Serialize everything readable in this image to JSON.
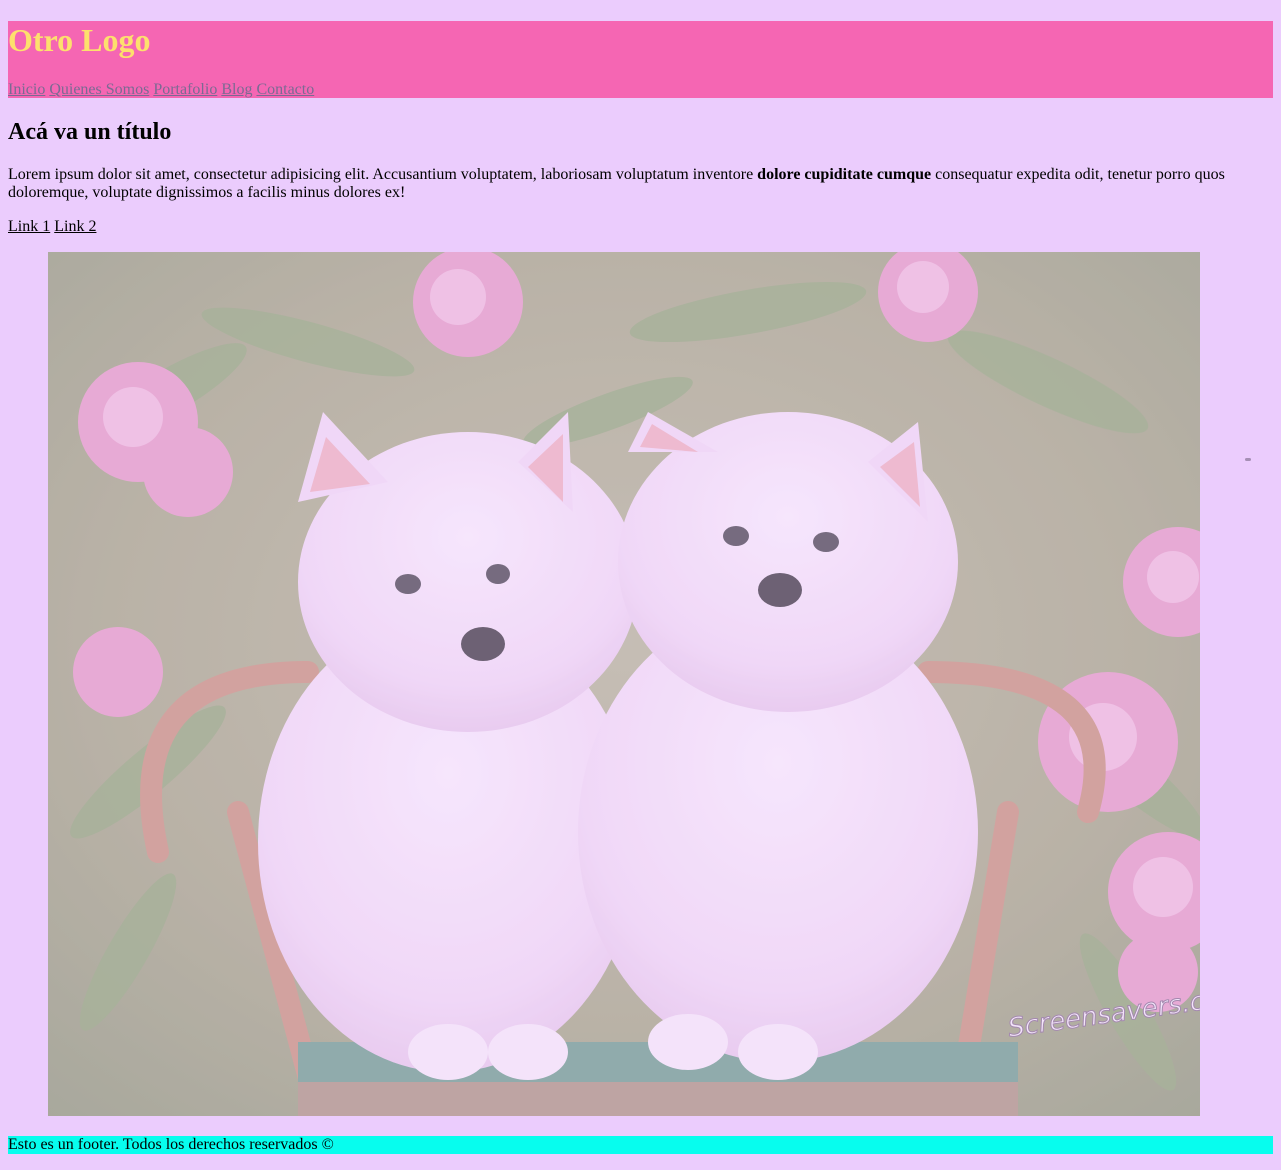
{
  "header": {
    "logo": "Otro Logo",
    "nav": [
      "Inicio",
      "Quienes Somos",
      "Portafolio",
      "Blog",
      "Contacto"
    ]
  },
  "main": {
    "title": "Acá va un título",
    "paragraph_start": "Lorem ipsum dolor sit amet, consectetur adipisicing elit. Accusantium voluptatem, laboriosam voluptatum inventore ",
    "paragraph_bold": "dolore cupiditate cumque",
    "paragraph_end": " consequatur expedita odit, tenetur porro quos doloremque, voluptate dignissimos a facilis minus dolores ex!",
    "links": [
      "Link 1",
      "Link 2"
    ]
  },
  "image": {
    "watermark": "Screensavers.com"
  },
  "footer": {
    "text": "Esto es un footer. Todos los derechos reservados ©"
  },
  "colors": {
    "page_bg": "#ebccfd",
    "header_bg": "#f566b3",
    "logo": "#fde06d",
    "nav_link": "#7b6a93",
    "footer_bg": "#07fdee"
  }
}
